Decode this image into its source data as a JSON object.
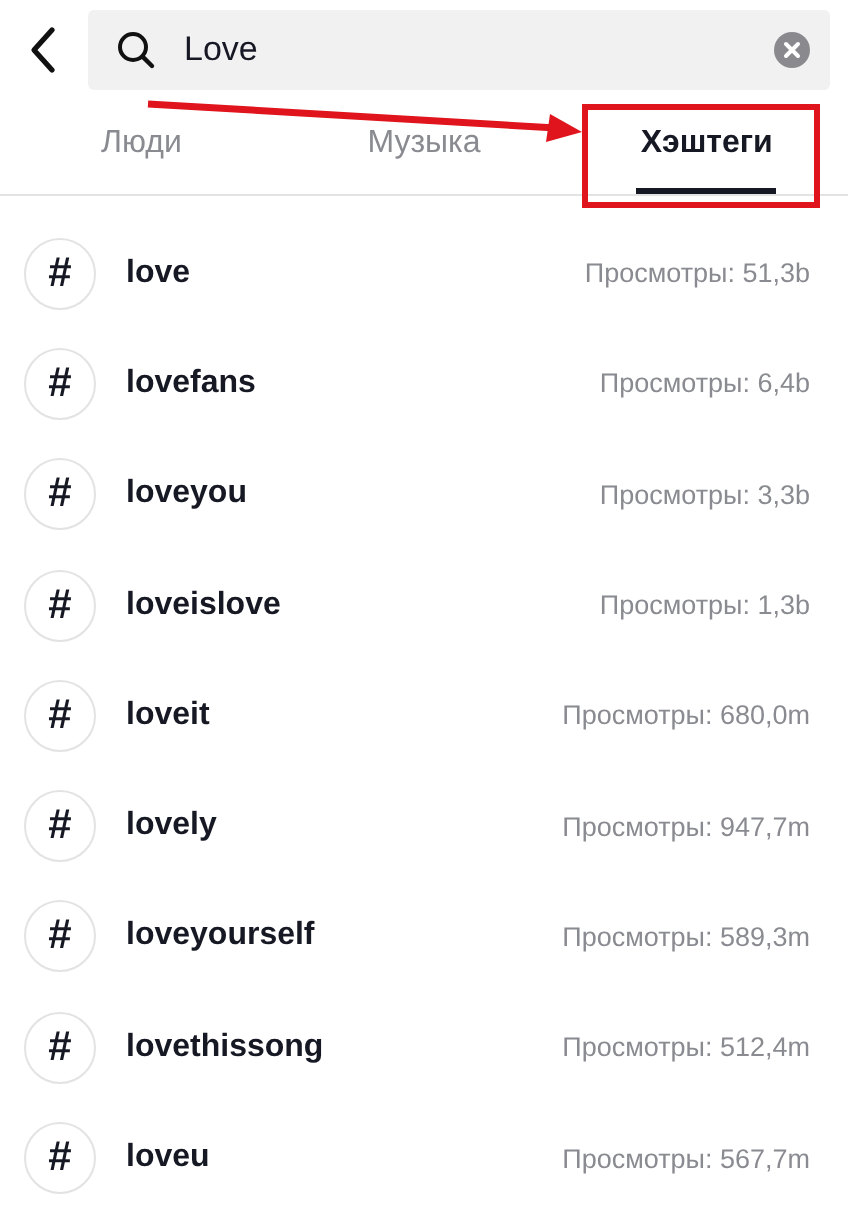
{
  "search": {
    "value": "Love"
  },
  "tabs": [
    {
      "label": "Люди",
      "selected": false,
      "highlighted": false
    },
    {
      "label": "Музыка",
      "selected": false,
      "highlighted": false
    },
    {
      "label": "Хэштеги",
      "selected": true,
      "highlighted": true
    }
  ],
  "hashtags": [
    {
      "icon": "#",
      "name": "love",
      "views": "Просмотры: 51,3b"
    },
    {
      "icon": "#",
      "name": "lovefans",
      "views": "Просмотры: 6,4b"
    },
    {
      "icon": "#",
      "name": "loveyou",
      "views": "Просмотры: 3,3b"
    },
    {
      "icon": "#",
      "name": "loveislove",
      "views": "Просмотры: 1,3b"
    },
    {
      "icon": "#",
      "name": "loveit",
      "views": "Просмотры: 680,0m"
    },
    {
      "icon": "#",
      "name": "lovely",
      "views": "Просмотры: 947,7m"
    },
    {
      "icon": "#",
      "name": "loveyourself",
      "views": "Просмотры: 589,3m"
    },
    {
      "icon": "#",
      "name": "lovethissong",
      "views": "Просмотры: 512,4m"
    },
    {
      "icon": "#",
      "name": "loveu",
      "views": "Просмотры: 567,7m"
    }
  ]
}
